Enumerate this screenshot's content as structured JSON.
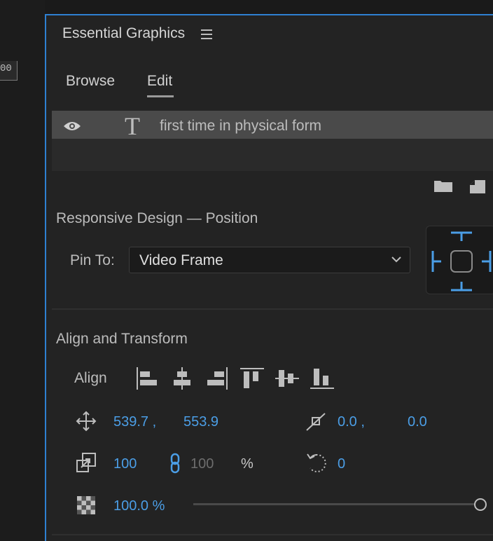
{
  "left_ruler": {
    "text": "00"
  },
  "panel": {
    "title": "Essential Graphics",
    "menu_icon": "hamburger-icon",
    "tabs": [
      {
        "label": "Browse",
        "active": false
      },
      {
        "label": "Edit",
        "active": true
      }
    ]
  },
  "layers": [
    {
      "name": "first time in physical form",
      "visible": true,
      "type_icon": "text-layer-icon"
    }
  ],
  "layer_actions": [
    "new-folder-icon",
    "new-item-icon"
  ],
  "responsive": {
    "title": "Responsive Design — Position",
    "pin_label": "Pin To:",
    "pin_value": "Video Frame"
  },
  "align_transform": {
    "title": "Align and Transform",
    "align_label": "Align",
    "align_buttons": [
      "align-left",
      "align-horizontal-center",
      "align-right",
      "align-top",
      "align-vertical-center",
      "align-bottom"
    ],
    "position": {
      "x": "539.7 ,",
      "y": "553.9"
    },
    "anchor": {
      "x": "0.0 ,",
      "y": "0.0"
    },
    "scale": {
      "value": "100",
      "linked_value": "100",
      "unit": "%"
    },
    "rotation": {
      "value": "0"
    },
    "opacity": {
      "value": "100.0 %",
      "fraction": 1.0
    }
  },
  "colors": {
    "accent": "#2e80d2",
    "value_blue": "#4b9ee6"
  }
}
